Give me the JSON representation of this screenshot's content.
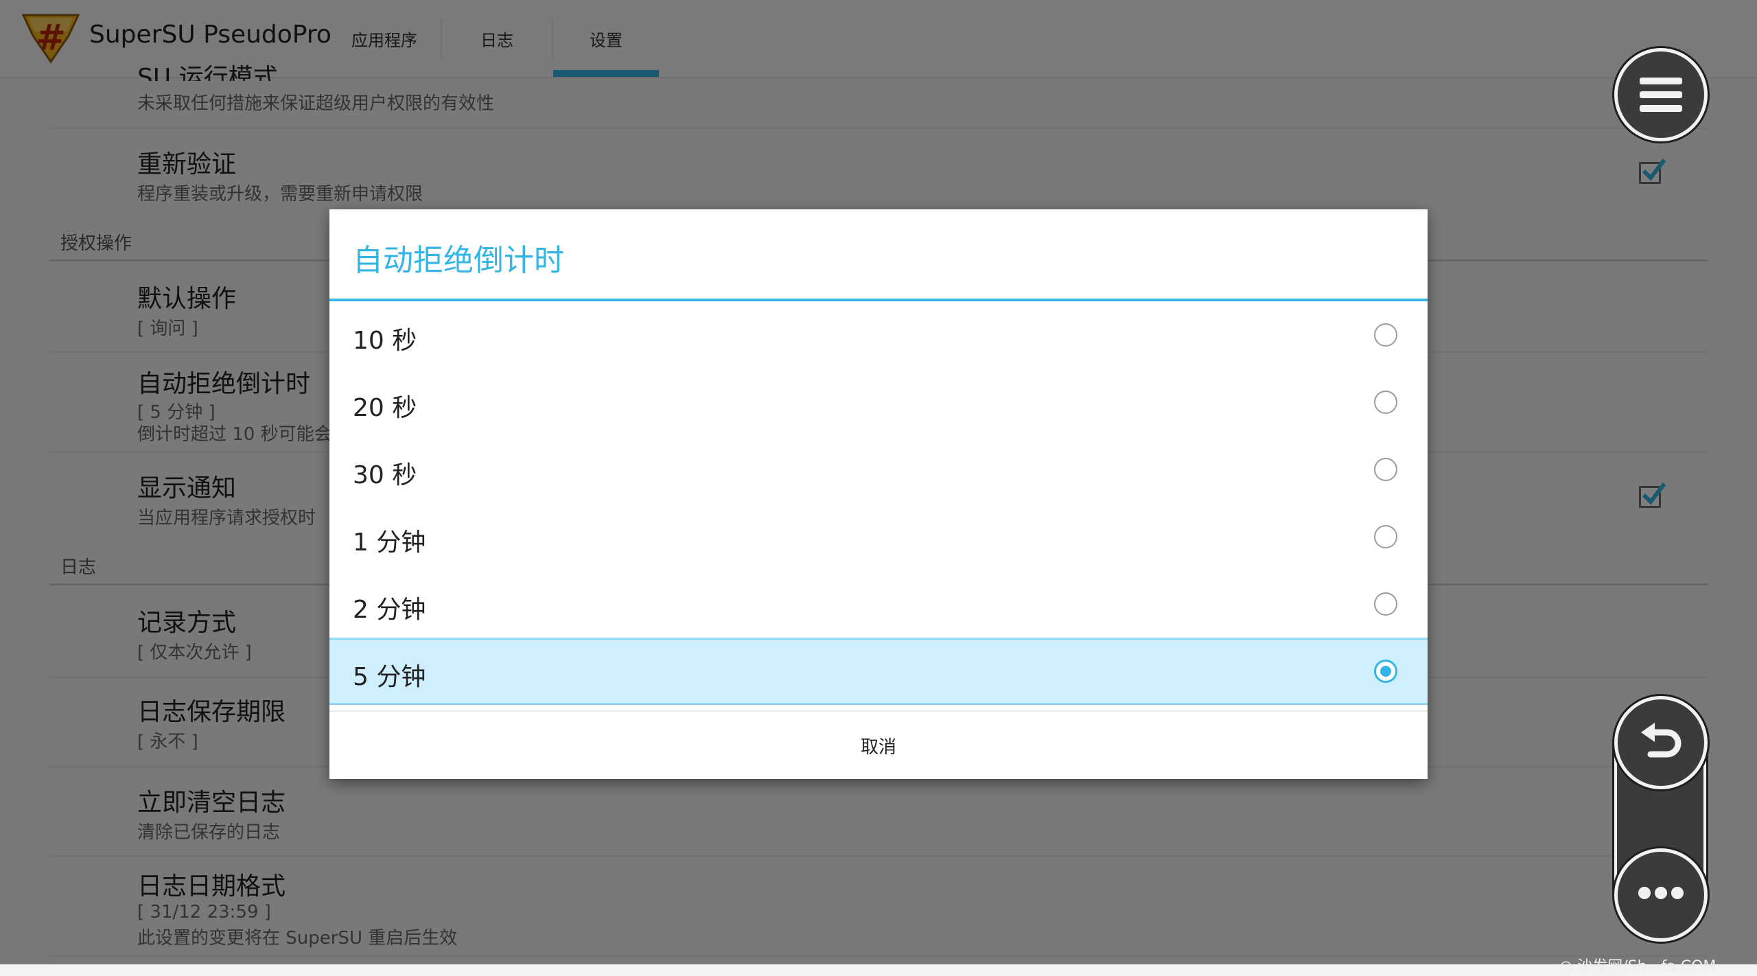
{
  "app": {
    "title": "SuperSU PseudoPro",
    "tabs": [
      {
        "label": "应用程序",
        "active": false
      },
      {
        "label": "日志",
        "active": false
      },
      {
        "label": "设置",
        "active": true
      }
    ],
    "accent_color": "#33b5e5"
  },
  "settings": {
    "partial_row": {
      "title": "SU 运行模式",
      "summary": "未采取任何措施来保证超级用户权限的有效性"
    },
    "reverify": {
      "title": "重新验证",
      "summary": "程序重装或升级，需要重新申请权限",
      "checked": true
    },
    "section_access": "授权操作",
    "default_action": {
      "title": "默认操作",
      "summary": "[ 询问 ]"
    },
    "auto_deny": {
      "title": "自动拒绝倒计时",
      "summary": "[ 5 分钟 ]",
      "summary2": "倒计时超过 10 秒可能会"
    },
    "show_notification": {
      "title": "显示通知",
      "summary": "当应用程序请求授权时",
      "checked": true
    },
    "section_log": "日志",
    "log_method": {
      "title": "记录方式",
      "summary": "[ 仅本次允许 ]"
    },
    "log_retention": {
      "title": "日志保存期限",
      "summary": "[ 永不 ]"
    },
    "clear_logs": {
      "title": "立即清空日志",
      "summary": "清除已保存的日志"
    },
    "date_format": {
      "title": "日志日期格式",
      "summary": "[ 31/12 23:59 ]",
      "summary2": "此设置的变更将在 SuperSU 重启后生效"
    }
  },
  "dialog": {
    "title": "自动拒绝倒计时",
    "options": [
      {
        "label": "10 秒",
        "selected": false
      },
      {
        "label": "20 秒",
        "selected": false
      },
      {
        "label": "30 秒",
        "selected": false
      },
      {
        "label": "1 分钟",
        "selected": false
      },
      {
        "label": "2 分钟",
        "selected": false
      },
      {
        "label": "5 分钟",
        "selected": true
      }
    ],
    "cancel_label": "取消"
  },
  "overlay": {
    "menu_icon": "hamburger-menu-icon",
    "back_icon": "back-arrow-icon",
    "more_icon": "more-dots-icon",
    "watermark": "○ 沙发网/Sh...fa.COM"
  }
}
